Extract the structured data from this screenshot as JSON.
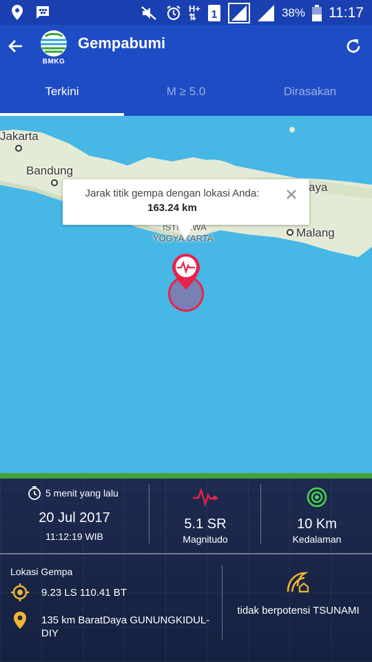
{
  "statusbar": {
    "battery": "38%",
    "time": "11:17",
    "network": "H+",
    "sim": "1"
  },
  "app": {
    "title": "Gempabumi",
    "logo_text": "BMKG"
  },
  "tabs": [
    {
      "label": "Terkini",
      "active": true
    },
    {
      "label": "M ≥ 5.0",
      "active": false
    },
    {
      "label": "Dirasakan",
      "active": false
    }
  ],
  "map": {
    "cities": [
      "Jakarta",
      "Bandung",
      "Malang",
      "ISTIMEWA",
      "YOGYAKARTA",
      "aya"
    ],
    "popup": {
      "line1": "Jarak titik gempa dengan lokasi Anda:",
      "distance": "163.24 km"
    }
  },
  "info": {
    "time_ago": "5 menit yang lalu",
    "date": "20 Jul 2017",
    "time": "11:12:19 WIB",
    "magnitude": {
      "value": "5.1 SR",
      "label": "Magnitudo"
    },
    "depth": {
      "value": "10 Km",
      "label": "Kedalaman"
    },
    "location_title": "Lokasi Gempa",
    "coordinates": "9.23 LS 110.41 BT",
    "region": "135 km BaratDaya GUNUNGKIDUL-DIY",
    "tsunami": "tidak berpotensi TSUNAMI"
  },
  "colors": {
    "appbar": "#1e4cc4",
    "sea": "#47b7e6",
    "quake": "#e8224a",
    "depth_icon": "#4cd64c",
    "tsunami_icon": "#f2b632"
  }
}
